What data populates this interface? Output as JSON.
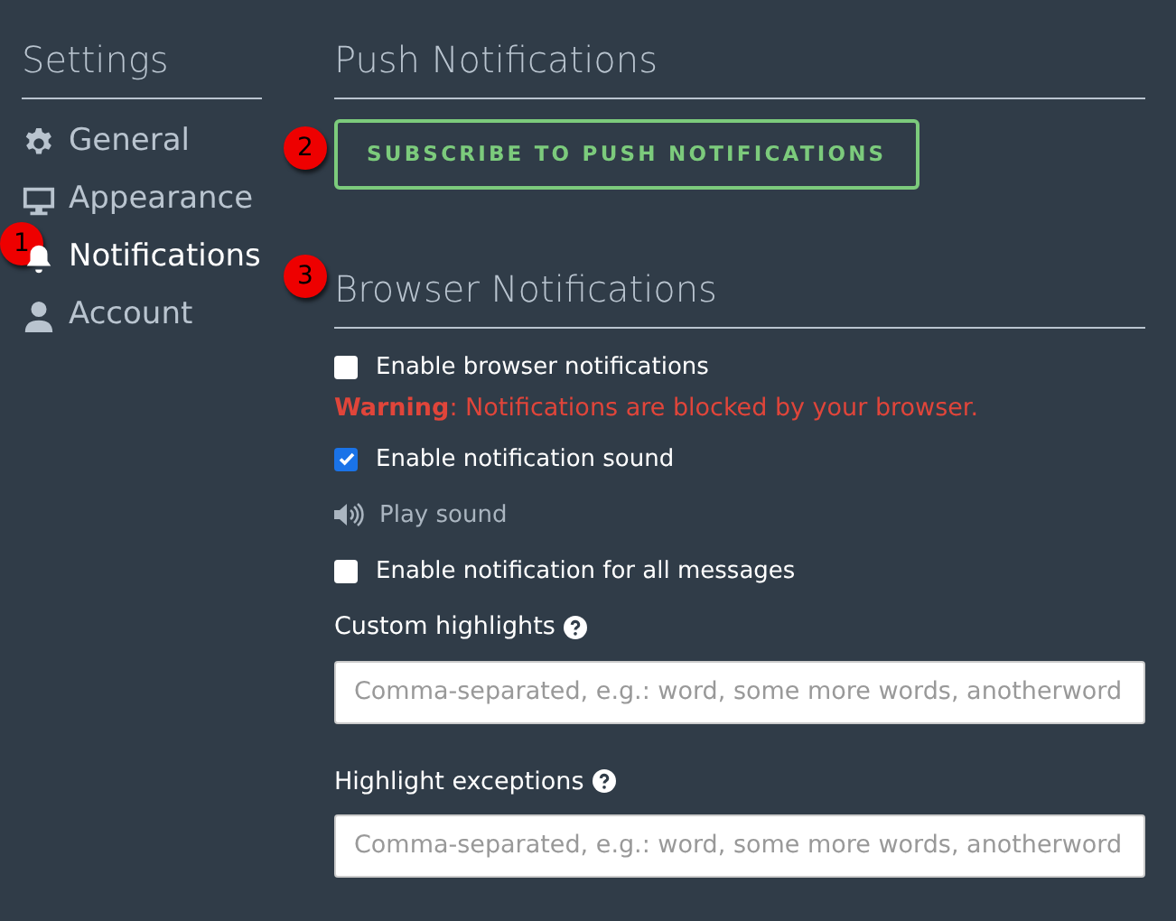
{
  "sidebar": {
    "title": "Settings",
    "items": [
      {
        "label": "General",
        "selected": false
      },
      {
        "label": "Appearance",
        "selected": false
      },
      {
        "label": "Notifications",
        "selected": true,
        "callout": "1"
      },
      {
        "label": "Account",
        "selected": false
      }
    ]
  },
  "push": {
    "title": "Push Notifications",
    "button": "SUBSCRIBE TO PUSH NOTIFICATIONS",
    "callout": "2"
  },
  "browser": {
    "title": "Browser Notifications",
    "callout": "3",
    "options": [
      {
        "kind": "checkbox",
        "label": "Enable browser notifications",
        "checked": false
      },
      {
        "kind": "warning",
        "text": "**Warning**: Notifications are blocked by your browser."
      },
      {
        "kind": "checkbox",
        "label": "Enable notification sound",
        "checked": true
      },
      {
        "kind": "action",
        "label": "Play sound"
      },
      {
        "kind": "checkbox",
        "label": "Enable notification for all messages",
        "checked": false
      }
    ],
    "fields": [
      {
        "label": "Custom highlights",
        "placeholder": "Comma-separated, e.g.: word, some more words, anotherword"
      },
      {
        "label": "Highlight exceptions",
        "placeholder": "Comma-separated, e.g.: word, some more words, anotherword"
      }
    ]
  }
}
